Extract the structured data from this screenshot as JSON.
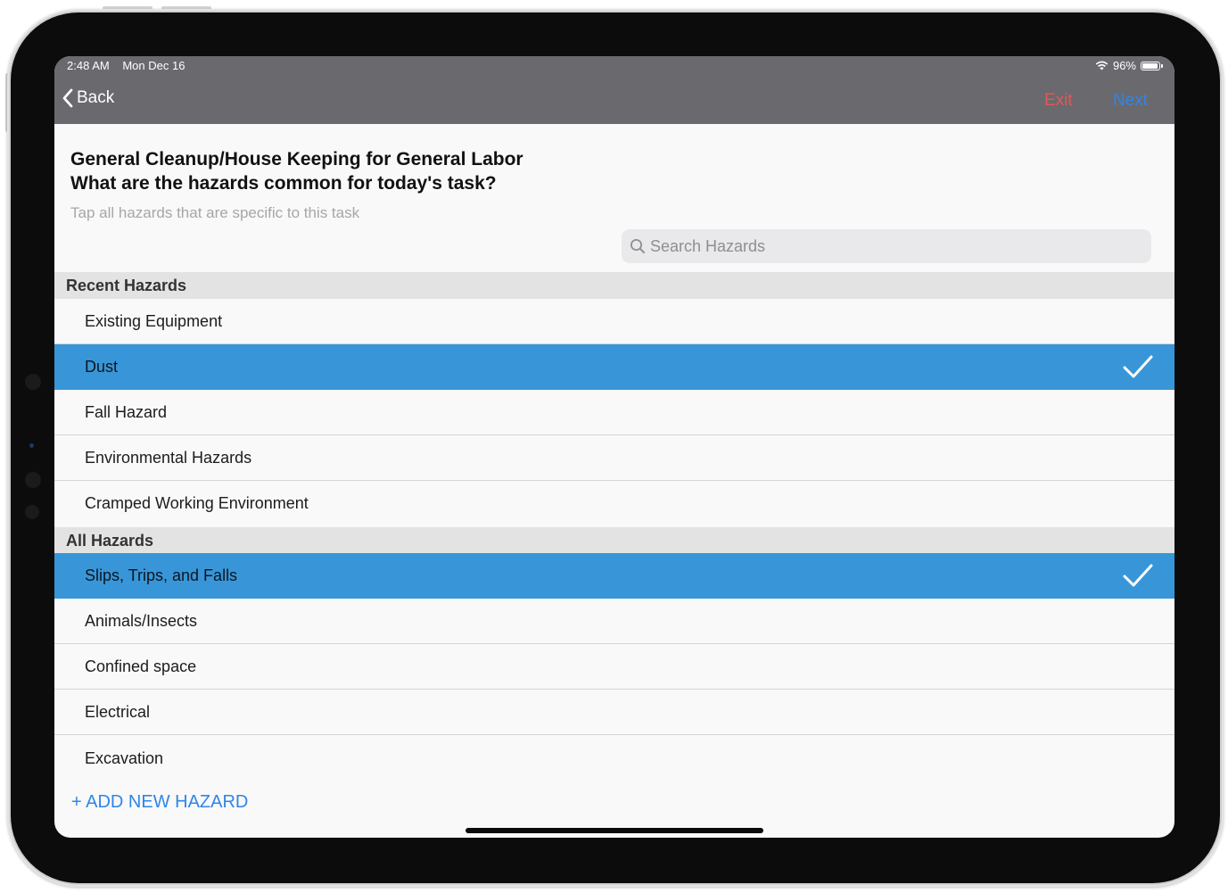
{
  "status_bar": {
    "time": "2:48 AM",
    "date": "Mon Dec 16",
    "battery": "96%"
  },
  "nav": {
    "back_label": "Back",
    "exit_label": "Exit",
    "next_label": "Next"
  },
  "header": {
    "task_title": "General Cleanup/House Keeping for General Labor",
    "question": "What are the hazards common for today's task?",
    "subtitle": "Tap all hazards that are specific to this task"
  },
  "search": {
    "placeholder": "Search Hazards"
  },
  "recent": {
    "title": "Recent Hazards",
    "items": [
      {
        "label": "Existing Equipment",
        "selected": false
      },
      {
        "label": "Dust",
        "selected": true
      },
      {
        "label": "Fall Hazard",
        "selected": false
      },
      {
        "label": "Environmental Hazards",
        "selected": false
      },
      {
        "label": "Cramped Working Environment",
        "selected": false
      }
    ]
  },
  "all": {
    "title": "All Hazards",
    "items": [
      {
        "label": "Slips, Trips, and Falls",
        "selected": true
      },
      {
        "label": "Animals/Insects",
        "selected": false
      },
      {
        "label": "Confined space",
        "selected": false
      },
      {
        "label": "Electrical",
        "selected": false
      },
      {
        "label": "Excavation",
        "selected": false
      }
    ]
  },
  "add_hazard_label": "+ ADD NEW HAZARD",
  "colors": {
    "selected_row": "#3896d8",
    "nav_bar": "#6a696e",
    "exit": "#e15858",
    "accent": "#2f86e6"
  }
}
